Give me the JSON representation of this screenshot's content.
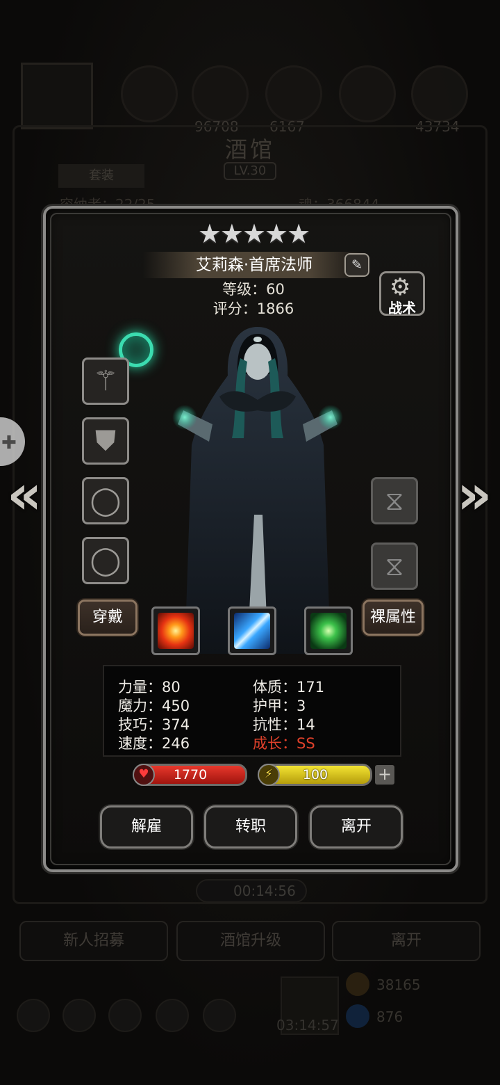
{
  "background": {
    "title": "酒馆",
    "level": "LV.30",
    "tab": "套装",
    "resources": [
      "96708",
      "6167",
      "",
      "43734"
    ],
    "stat_left": "容纳者：22/25",
    "stat_right": "魂：366844",
    "timer": "00:14:56",
    "buttons": [
      "新人招募",
      "酒馆升级",
      "离开"
    ],
    "gift_timer": "03:14:57",
    "currency_1": "38165",
    "currency_2": "876"
  },
  "hero": {
    "stars": "★★★★★",
    "star_count": 5,
    "name": "艾莉森·首席法师",
    "level_line": "等级：60",
    "score_line": "评分：1866",
    "tactics_label": "战术",
    "equip_label": "穿戴",
    "naked_label": "裸属性",
    "skills": [
      "fire",
      "ice",
      "nature"
    ],
    "stats": {
      "strength": "力量：80",
      "magic": "魔力：450",
      "skill": "技巧：374",
      "speed": "速度：246",
      "constitution": "体质：171",
      "armor": "护甲：3",
      "resist": "抗性：14",
      "growth": "成长：SS"
    },
    "hp": "1770",
    "mp": "100",
    "actions": [
      "解雇",
      "转职",
      "离开"
    ]
  },
  "colors": {
    "growth": "#e0412b",
    "hp": "#d3261c",
    "mp": "#e8d82a",
    "orb": "#3bdcb0"
  },
  "icons": {
    "equip_slots": [
      "staff-icon",
      "armor-icon",
      "ring-icon",
      "ring-icon"
    ],
    "right_slots": [
      "hourglass-icon",
      "hourglass-icon"
    ]
  }
}
